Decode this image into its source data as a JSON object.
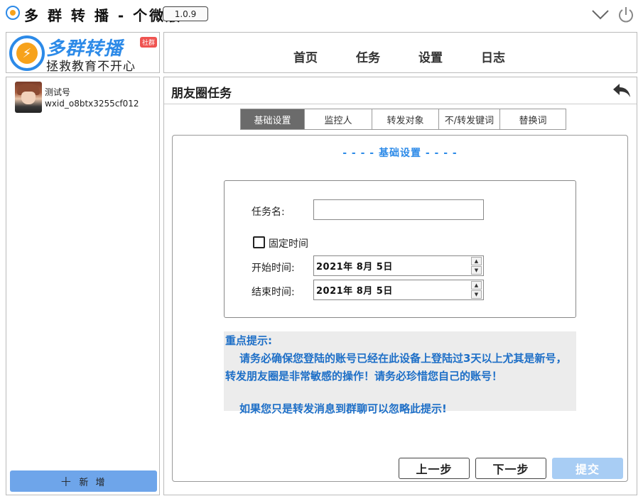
{
  "titlebar": {
    "title": "多 群 转 播 - 个微版",
    "version": "1.0.9",
    "collapse_icon": "chevron-down-icon",
    "power_icon": "power-icon"
  },
  "logo": {
    "name": "多群转播",
    "tag": "社群",
    "slogan": "拯救教育不开心",
    "brand_color": "#2c8ae8",
    "accent_color": "#f7a21b"
  },
  "nav": {
    "items": [
      {
        "label": "首页"
      },
      {
        "label": "任务"
      },
      {
        "label": "设置"
      },
      {
        "label": "日志"
      }
    ]
  },
  "accounts": [
    {
      "name": "测试号",
      "wxid": "wxid_o8btx3255cf012"
    }
  ],
  "sidebar": {
    "add_label": "新 增",
    "add_color": "#6ea5ea"
  },
  "main": {
    "title": "朋友圈任务",
    "back_icon": "back-arrow-icon",
    "tabs": [
      {
        "label": "基础设置",
        "active": true
      },
      {
        "label": "监控人",
        "active": false
      },
      {
        "label": "转发对象",
        "active": false
      },
      {
        "label": "不/转发键词",
        "active": false
      },
      {
        "label": "替换词",
        "active": false
      }
    ],
    "section_heading": "- - - - 基础设置 - - - -"
  },
  "form": {
    "task_name_label": "任务名:",
    "task_name_value": "",
    "fixed_time_label": "固定时间",
    "fixed_time_checked": false,
    "start_label": "开始时间:",
    "start_value": "2021年  8月  5日",
    "end_label": "结束时间:",
    "end_value": "2021年  8月  5日"
  },
  "notice": {
    "title": "重点提示:",
    "paragraph1": "请务必确保您登陆的账号已经在此设备上登陆过3天以上尤其是新号，转发朋友圈是非常敏感的操作！请务必珍惜您自己的账号！",
    "paragraph2": "如果您只是转发消息到群聊可以忽略此提示!",
    "color": "#1e6fc7"
  },
  "buttons": {
    "prev": "上一步",
    "next": "下一步",
    "submit": "提交"
  }
}
